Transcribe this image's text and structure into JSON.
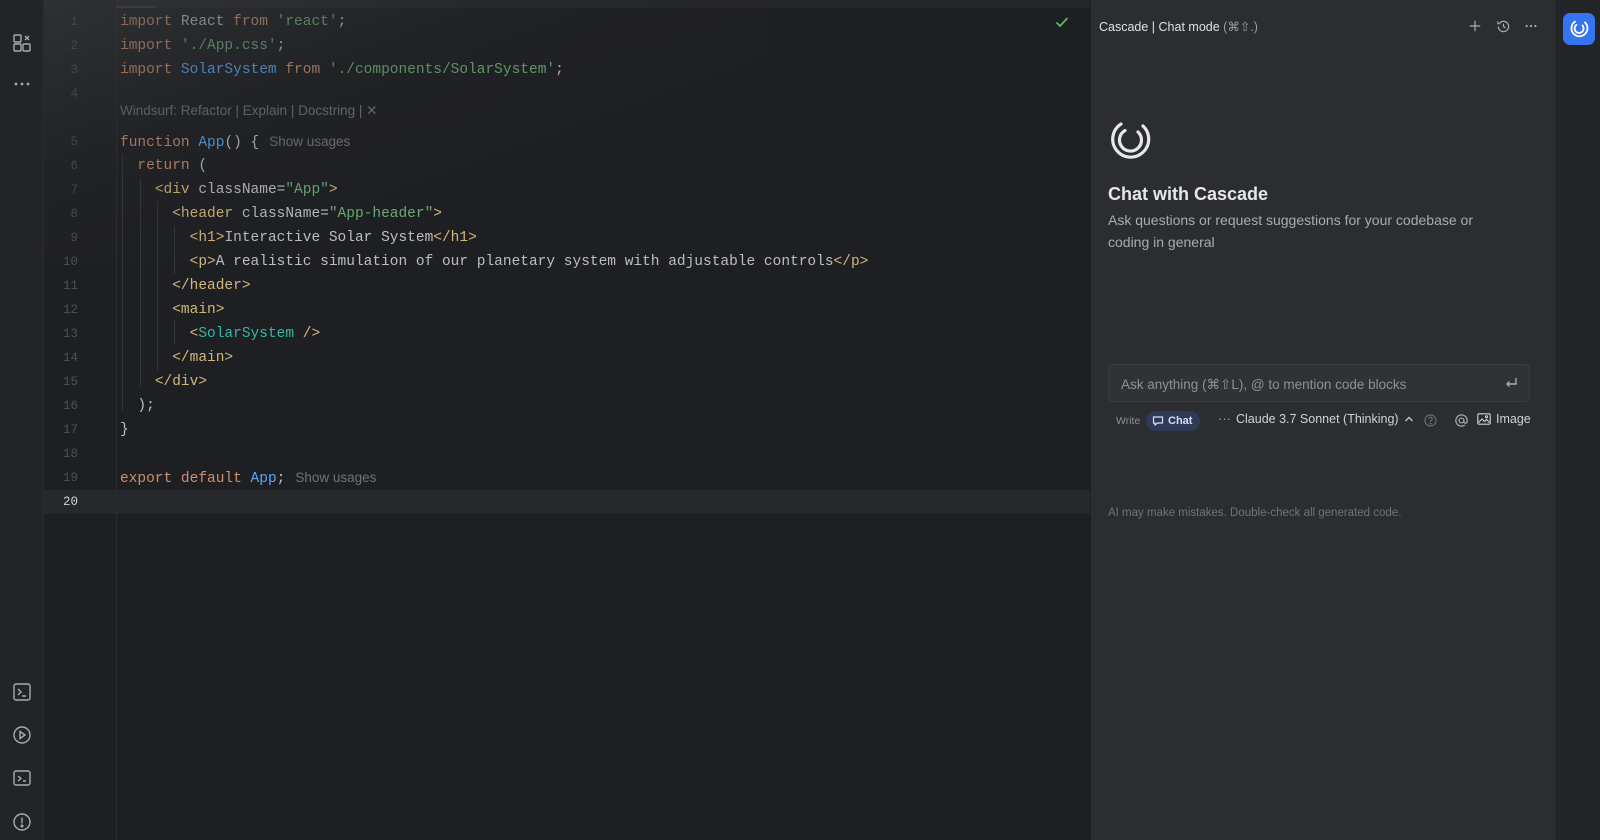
{
  "editor": {
    "lines": [
      {
        "n": "1",
        "tokens": [
          {
            "t": "import",
            "c": "kw"
          },
          {
            "t": " React ",
            "c": "plain"
          },
          {
            "t": "from",
            "c": "kw"
          },
          {
            "t": " ",
            "c": "plain"
          },
          {
            "t": "'react'",
            "c": "str"
          },
          {
            "t": ";",
            "c": "plain"
          }
        ]
      },
      {
        "n": "2",
        "tokens": [
          {
            "t": "import",
            "c": "kw"
          },
          {
            "t": " ",
            "c": "plain"
          },
          {
            "t": "'./App.css'",
            "c": "str"
          },
          {
            "t": ";",
            "c": "plain"
          }
        ]
      },
      {
        "n": "3",
        "tokens": [
          {
            "t": "import",
            "c": "kw"
          },
          {
            "t": " ",
            "c": "plain"
          },
          {
            "t": "SolarSystem",
            "c": "fn"
          },
          {
            "t": " ",
            "c": "plain"
          },
          {
            "t": "from",
            "c": "kw"
          },
          {
            "t": " ",
            "c": "plain"
          },
          {
            "t": "'./components/SolarSystem'",
            "c": "str"
          },
          {
            "t": ";",
            "c": "plain"
          }
        ]
      },
      {
        "n": "4",
        "tokens": []
      },
      {
        "n": "5",
        "tokens": [
          {
            "t": "function",
            "c": "kw"
          },
          {
            "t": " ",
            "c": "plain"
          },
          {
            "t": "App",
            "c": "fn"
          },
          {
            "t": "() {",
            "c": "plain"
          }
        ],
        "hint": "Show usages"
      },
      {
        "n": "6",
        "tokens": [
          {
            "t": "  ",
            "c": "plain"
          },
          {
            "t": "return",
            "c": "kw"
          },
          {
            "t": " (",
            "c": "plain"
          }
        ]
      },
      {
        "n": "7",
        "tokens": [
          {
            "t": "    ",
            "c": "plain"
          },
          {
            "t": "<div",
            "c": "tag"
          },
          {
            "t": " className",
            "c": "attr"
          },
          {
            "t": "=",
            "c": "plain"
          },
          {
            "t": "\"App\"",
            "c": "attrval"
          },
          {
            "t": ">",
            "c": "tag"
          }
        ]
      },
      {
        "n": "8",
        "tokens": [
          {
            "t": "      ",
            "c": "plain"
          },
          {
            "t": "<header",
            "c": "tag"
          },
          {
            "t": " className",
            "c": "attr"
          },
          {
            "t": "=",
            "c": "plain"
          },
          {
            "t": "\"App-header\"",
            "c": "attrval"
          },
          {
            "t": ">",
            "c": "tag"
          }
        ]
      },
      {
        "n": "9",
        "tokens": [
          {
            "t": "        ",
            "c": "plain"
          },
          {
            "t": "<h1>",
            "c": "tag"
          },
          {
            "t": "Interactive Solar System",
            "c": "plain"
          },
          {
            "t": "</h1>",
            "c": "tag"
          }
        ]
      },
      {
        "n": "10",
        "tokens": [
          {
            "t": "        ",
            "c": "plain"
          },
          {
            "t": "<p>",
            "c": "tag"
          },
          {
            "t": "A realistic simulation of our planetary system with adjustable controls",
            "c": "plain"
          },
          {
            "t": "</p>",
            "c": "tag"
          }
        ]
      },
      {
        "n": "11",
        "tokens": [
          {
            "t": "      ",
            "c": "plain"
          },
          {
            "t": "</header>",
            "c": "tag"
          }
        ]
      },
      {
        "n": "12",
        "tokens": [
          {
            "t": "      ",
            "c": "plain"
          },
          {
            "t": "<main>",
            "c": "tag"
          }
        ]
      },
      {
        "n": "13",
        "tokens": [
          {
            "t": "        ",
            "c": "plain"
          },
          {
            "t": "<",
            "c": "tag"
          },
          {
            "t": "SolarSystem",
            "c": "comp"
          },
          {
            "t": " />",
            "c": "tag"
          }
        ]
      },
      {
        "n": "14",
        "tokens": [
          {
            "t": "      ",
            "c": "plain"
          },
          {
            "t": "</main>",
            "c": "tag"
          }
        ]
      },
      {
        "n": "15",
        "tokens": [
          {
            "t": "    ",
            "c": "plain"
          },
          {
            "t": "</div>",
            "c": "tag"
          }
        ]
      },
      {
        "n": "16",
        "tokens": [
          {
            "t": "  );",
            "c": "plain"
          }
        ]
      },
      {
        "n": "17",
        "tokens": [
          {
            "t": "}",
            "c": "plain"
          }
        ]
      },
      {
        "n": "18",
        "tokens": []
      },
      {
        "n": "19",
        "tokens": [
          {
            "t": "export",
            "c": "kw"
          },
          {
            "t": " ",
            "c": "plain"
          },
          {
            "t": "default",
            "c": "kw"
          },
          {
            "t": " ",
            "c": "plain"
          },
          {
            "t": "App",
            "c": "fn"
          },
          {
            "t": ";",
            "c": "plain"
          }
        ],
        "hint": "Show usages"
      },
      {
        "n": "20",
        "tokens": [],
        "current": true
      }
    ],
    "codelens": "Windsurf: Refactor | Explain | Docstring | ✕"
  },
  "panel": {
    "title": "Cascade | Chat mode",
    "title_shortcut": "(⌘⇧.)",
    "heading": "Chat with Cascade",
    "description": "Ask questions or request suggestions for your codebase or coding in general",
    "input_placeholder": "Ask anything (⌘⇧L), @ to mention code blocks",
    "mode_write": "Write",
    "mode_chat": "Chat",
    "mode_more": "···",
    "model": "Claude 3.7 Sonnet (Thinking)",
    "image_label": "Image",
    "disclaimer": "AI may make mistakes. Double-check all generated code."
  },
  "colors": {
    "accent": "#3574f0",
    "chat_pill": "#2f3a55",
    "check": "#5fb85f"
  }
}
